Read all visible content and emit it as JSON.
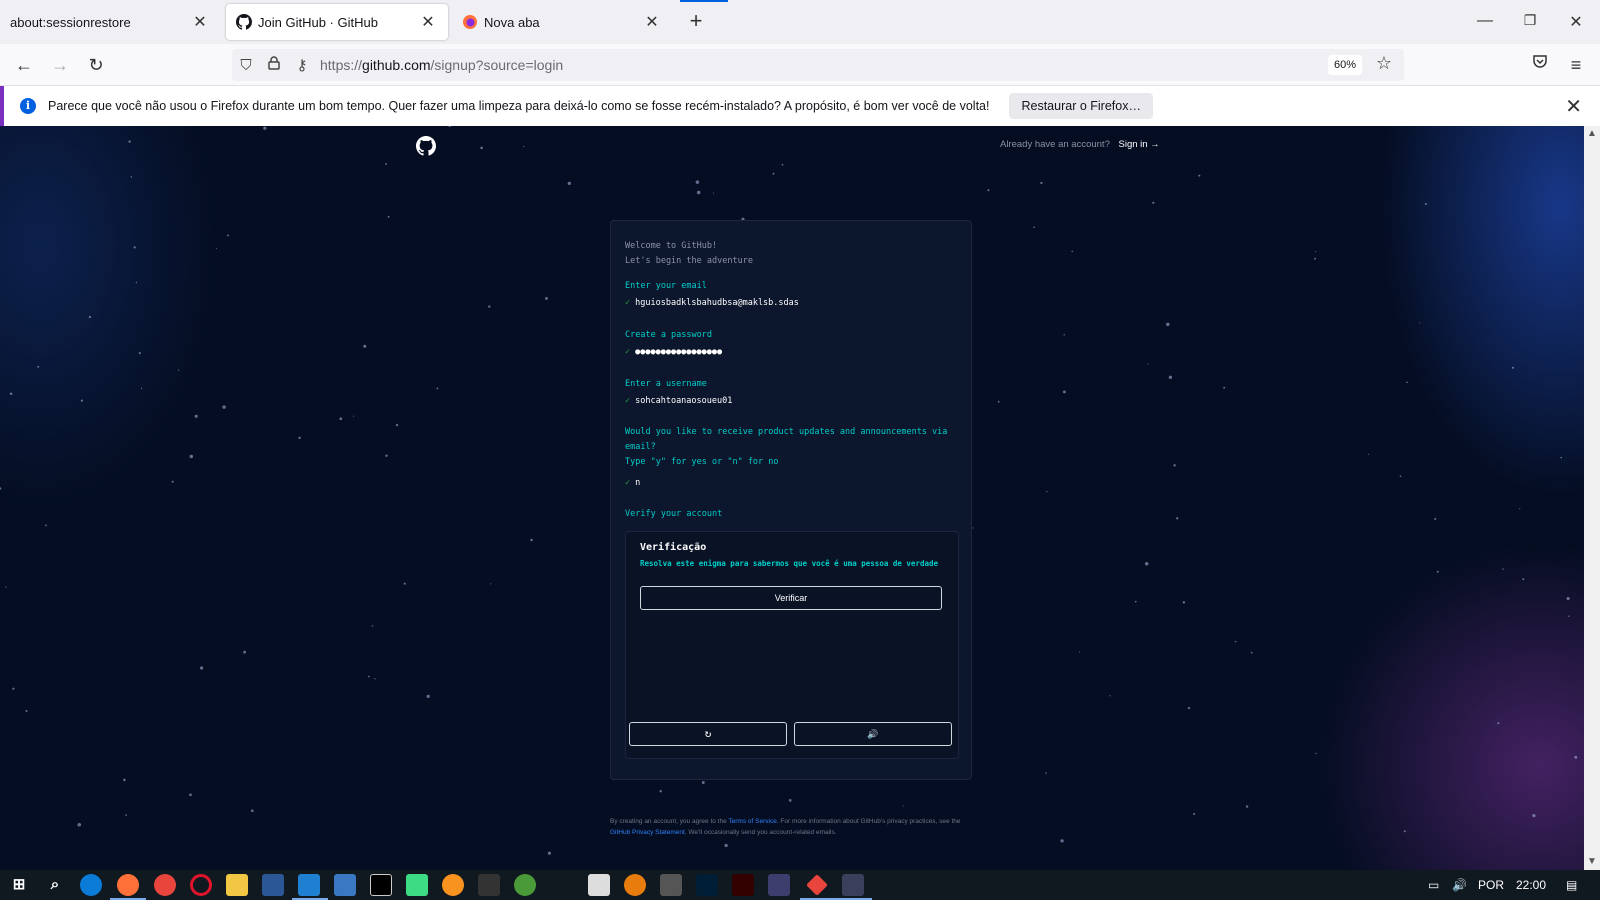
{
  "browser": {
    "tabs": [
      {
        "title": "about:sessionrestore",
        "active": false
      },
      {
        "title": "Join GitHub · GitHub",
        "active": true
      },
      {
        "title": "Nova aba",
        "active": false
      }
    ],
    "new_tab": "+",
    "url_prefix": "https://",
    "url_host": "github.com",
    "url_path": "/signup?source=login",
    "zoom": "60%"
  },
  "notification": {
    "message": "Parece que você não usou o Firefox durante um bom tempo. Quer fazer uma limpeza para deixá-lo como se fosse recém-instalado? A propósito, é bom ver você de volta!",
    "button": "Restaurar o Firefox…"
  },
  "page": {
    "header": {
      "already": "Already have an account?",
      "signin": "Sign in →"
    },
    "welcome_line1": "Welcome to GitHub!",
    "welcome_line2": "Let's begin the adventure",
    "email_label": "Enter your email",
    "email_value": "hguiosbadklsbahudbsa@maklsb.sdas",
    "password_label": "Create a password",
    "password_value": "●●●●●●●●●●●●●●●●●",
    "username_label": "Enter a username",
    "username_value": "sohcahtoanaosoueu01",
    "updates_question": "Would you like to receive product updates and announcements via email?",
    "updates_hint": "Type \"y\" for yes or \"n\" for no",
    "updates_value": "n",
    "verify_label": "Verify your account",
    "check_mark": "✓",
    "verification": {
      "title": "Verificação",
      "description": "Resolva este enigma para sabermos que você é uma pessoa de verdade",
      "button": "Verificar",
      "refresh_icon": "↻",
      "audio_icon": "🔊"
    },
    "terms": {
      "part1": "By creating an account, you agree to the ",
      "terms_link": "Terms of Service",
      "part2": ". For more information about GitHub's privacy practices, see the ",
      "privacy_link": "GitHub Privacy Statement",
      "part3": ". We'll occasionally send you account-related emails."
    }
  },
  "taskbar": {
    "language": "POR",
    "time": "22:00"
  },
  "colors": {
    "accent_cyan": "#00cfc8",
    "success_green": "#2ea043",
    "page_bg": "#040d21",
    "notification_border": "#7b2fbe"
  }
}
